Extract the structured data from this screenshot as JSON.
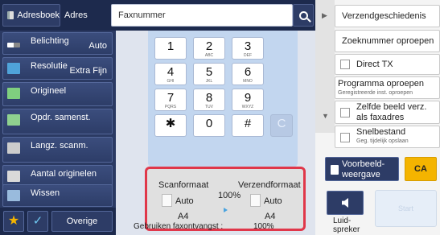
{
  "top_bar": {
    "address_book_label": "Adresboek",
    "adres_label": "Adres",
    "fax_field_value": "Faxnummer",
    "search_icon": "search-icon"
  },
  "left_menu": [
    {
      "label": "Belichting",
      "value": "Auto"
    },
    {
      "label": "Resolutie",
      "value": "Extra Fijn"
    },
    {
      "label": "Origineel",
      "value": ""
    },
    {
      "label": "Opdr. samenst.",
      "value": ""
    },
    {
      "label": "Langz. scanm.",
      "value": ""
    },
    {
      "label": "Aantal originelen",
      "value": ""
    },
    {
      "label": "Wissen",
      "value": ""
    }
  ],
  "bottom_left": {
    "favorite_icon": "star-icon",
    "check_icon": "check-icon",
    "more_label": "Overige"
  },
  "keypad": [
    {
      "d": "1",
      "s": ""
    },
    {
      "d": "2",
      "s": "ABC"
    },
    {
      "d": "3",
      "s": "DEF"
    },
    {
      "d": "4",
      "s": "GHI"
    },
    {
      "d": "5",
      "s": "JKL"
    },
    {
      "d": "6",
      "s": "MNO"
    },
    {
      "d": "7",
      "s": "PQRS"
    },
    {
      "d": "8",
      "s": "TUV"
    },
    {
      "d": "9",
      "s": "WXYZ"
    },
    {
      "d": "✱",
      "s": ""
    },
    {
      "d": "0",
      "s": ""
    },
    {
      "d": "#",
      "s": ""
    },
    {
      "d": "C",
      "s": ""
    }
  ],
  "scan_panel": {
    "scan_format_label": "Scanformaat",
    "send_format_label": "Verzendformaat",
    "scan_auto": "Auto",
    "send_auto": "Auto",
    "ratio": "100%",
    "scan_size": "A4",
    "send_size": "A4",
    "received_fax_label": "Gebruiken faxontvangst :",
    "received_fax_ratio": "100%"
  },
  "right_menu": {
    "send_history": "Verzendgeschiedenis",
    "recall_search": "Zoeknummer oproepen",
    "direct_tx": "Direct TX",
    "call_program": "Programma oproepen",
    "call_program_sub": "Geregistreerde inst. oproepen",
    "same_image": "Zelfde beeld verz. als faxadres",
    "quick_file": "Snelbestand",
    "quick_file_sub": "Geg. tijdelijk opslaan"
  },
  "bottom_right": {
    "preview_label": "Voorbeeld-\nweergave",
    "ca_label": "CA",
    "speaker_label": "Luid-\nspreker",
    "start_label": "Start"
  },
  "colors": {
    "nav_dark": "#1d2a4d",
    "nav": "#2d3c66",
    "accent": "#f4b400",
    "highlight": "#e0374a"
  }
}
